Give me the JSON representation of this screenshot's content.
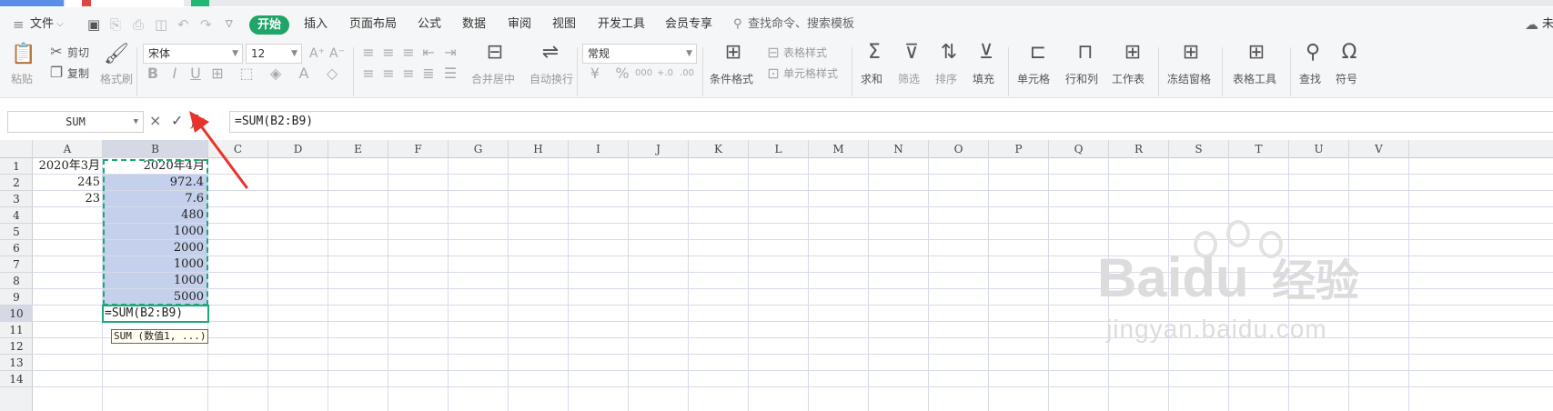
{
  "menu": {
    "file": "文件",
    "start": "开始",
    "tabs": [
      "插入",
      "页面布局",
      "公式",
      "数据",
      "审阅",
      "视图",
      "开发工具",
      "会员专享"
    ],
    "search": "查找命令、搜索模板",
    "right_partial": "未"
  },
  "ribbon": {
    "paste": "粘贴",
    "cut": "剪切",
    "copy": "复制",
    "format_painter": "格式刷",
    "font_name": "宋体",
    "font_size": "12",
    "merge_center": "合并居中",
    "wrap_text": "自动换行",
    "number_format": "常规",
    "cond_format": "条件格式",
    "table_style": "表格样式",
    "cell_style": "单元格样式",
    "sum": "求和",
    "filter": "筛选",
    "sort": "排序",
    "fill": "填充",
    "cell": "单元格",
    "row_col": "行和列",
    "worksheet": "工作表",
    "freeze": "冻结窗格",
    "table_tools": "表格工具",
    "find": "查找",
    "symbol": "符号"
  },
  "formula_bar": {
    "name_box": "SUM",
    "cancel": "×",
    "confirm": "✓",
    "fx": "fx",
    "formula": "=SUM(B2:B9)"
  },
  "columns": [
    "A",
    "B",
    "C",
    "D",
    "E",
    "F",
    "G",
    "H",
    "I",
    "J",
    "K",
    "L",
    "M",
    "N",
    "O",
    "P",
    "Q",
    "R",
    "S",
    "T",
    "U",
    "V"
  ],
  "rows": [
    "1",
    "2",
    "3",
    "4",
    "5",
    "6",
    "7",
    "8",
    "9",
    "10",
    "11",
    "12",
    "13",
    "14"
  ],
  "cells": {
    "a1": "2020年3月",
    "a2": "245",
    "a3": "23",
    "b1": "2020年4月",
    "b2": "972.4",
    "b3": "7.6",
    "b4": "480",
    "b5": "1000",
    "b6": "2000",
    "b7": "1000",
    "b8": "1000",
    "b9": "5000",
    "b10": "=SUM(B2:B9)"
  },
  "tooltip": "SUM (数值1, ...)",
  "watermark": {
    "brand": "Baidu",
    "brand_cn": "经验",
    "url": "jingyan.baidu.com"
  },
  "colors": {
    "accent_green": "#1fa567",
    "selection": "#c5d0ec",
    "arrow": "#e8332a"
  }
}
